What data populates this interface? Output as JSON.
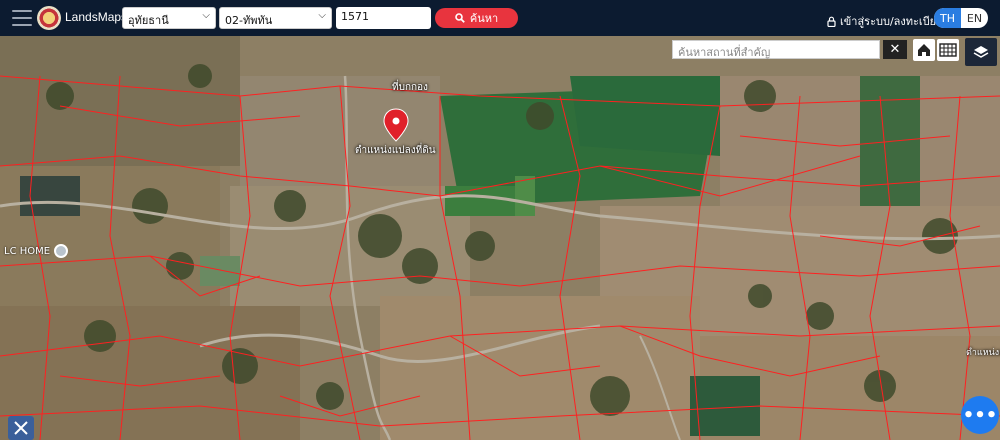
{
  "header": {
    "brand": "LandsMaps",
    "province": "อุทัยธานี",
    "district": "02-ทัพทัน",
    "parcel_number": "1571",
    "search_label": "ค้นหา",
    "login_label": "เข้าสู่ระบบ/ลงทะเบียน",
    "lang_th": "TH",
    "lang_en": "EN",
    "active_lang": "TH"
  },
  "map": {
    "place_search_placeholder": "ค้นหาสถานที่สำคัญ",
    "label_pond": "ที่บกกอง",
    "label_parcel": "ตำแหน่งแปลงที่ดิน",
    "label_lc_home": "LC HOME",
    "label_parcel_edge": "ตำแหน่งแปลงที่ดิน"
  },
  "colors": {
    "accent": "#e8343e",
    "lang_active": "#2a7de1",
    "fab": "#1e7bf0",
    "parcel_line": "#ff2020"
  },
  "icons": [
    "menu-icon",
    "chevron-down-icon",
    "search-icon",
    "lock-icon",
    "close-icon",
    "home-icon",
    "grid-icon",
    "layers-icon",
    "map-pin-icon",
    "tools-icon",
    "more-icon"
  ]
}
